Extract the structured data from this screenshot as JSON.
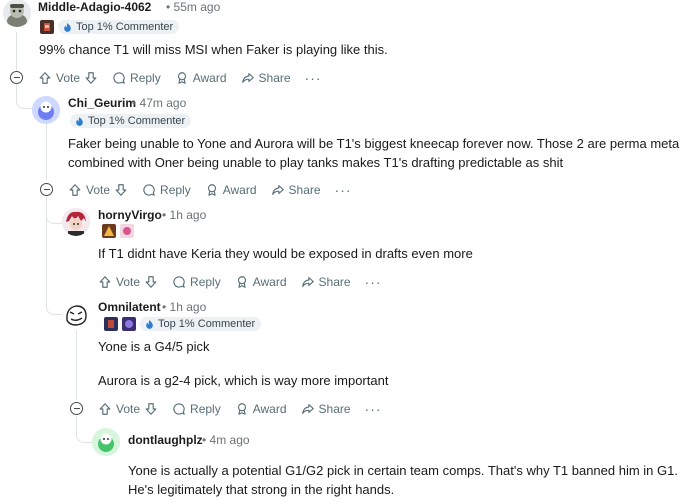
{
  "colors": {
    "accent": "#0079d3",
    "text": "#1a1a1b",
    "muted": "#6a7378",
    "line": "#e0e3e6"
  },
  "actions": {
    "vote": "Vote",
    "reply": "Reply",
    "award": "Award",
    "share": "Share",
    "more": "···"
  },
  "comments": [
    {
      "username": "Middle-Adagio-4062",
      "time": "55m ago",
      "flair": "Top 1% Commenter",
      "body": "99% chance T1 will miss MSI when Faker is playing like this."
    },
    {
      "username": "Chi_Geurim",
      "time": "47m ago",
      "flair": "Top 1% Commenter",
      "body": "Faker being unable to Yone and Aurora will be T1's biggest kneecap forever now. Those 2 are perma meta combined with Oner being unable to play tanks makes T1's drafting predictable as shit"
    },
    {
      "username": "hornyVirgo",
      "time": "1h ago",
      "body": "If T1 didnt have Keria they would be exposed in drafts even more"
    },
    {
      "username": "Omnilatent",
      "time": "1h ago",
      "flair": "Top 1% Commenter",
      "body_lines": [
        "Yone is a G4/5 pick",
        "Aurora is a g2-4 pick, which is way more important"
      ]
    },
    {
      "username": "dontlaughplz",
      "time": "4m ago",
      "body": "Yone is actually a potential G1/G2 pick in certain team comps. That's why T1 banned him in G1. He's legitimately that strong in the right hands."
    }
  ],
  "separator": "•"
}
